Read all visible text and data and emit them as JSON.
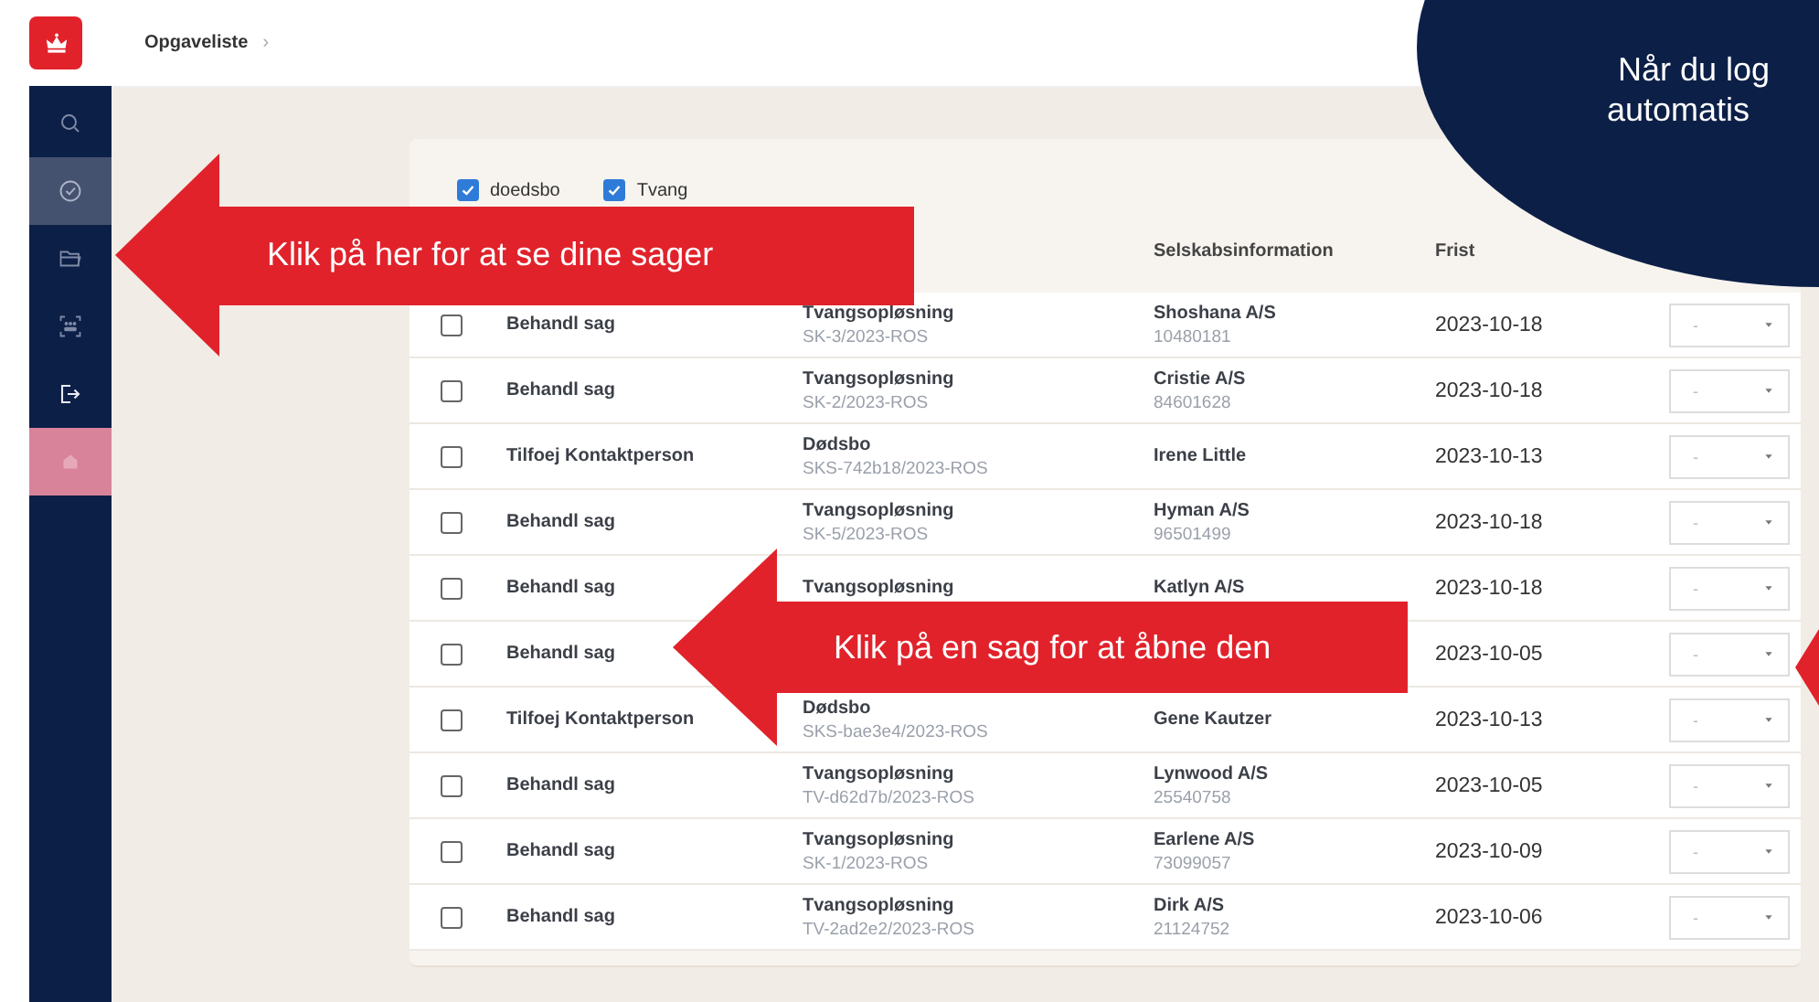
{
  "header": {
    "breadcrumb": "Opgaveliste",
    "separator": "›"
  },
  "sidebar": {
    "items": [
      {
        "kind": "search",
        "selected": false
      },
      {
        "kind": "check",
        "selected": true
      },
      {
        "kind": "folder",
        "selected": false
      },
      {
        "kind": "group",
        "selected": false
      },
      {
        "kind": "logout",
        "selected": false
      },
      {
        "kind": "profile",
        "selected": false
      }
    ]
  },
  "filters": [
    {
      "label": "doedsbo",
      "checked": true
    },
    {
      "label": "Tvang",
      "checked": true
    }
  ],
  "table": {
    "columns": {
      "company": "Selskabsinformation",
      "deadline": "Frist"
    },
    "rows": [
      {
        "checked": false,
        "task": "Behandl sag",
        "case_type": "Tvangsopløsning",
        "case_no": "SK-3/2023-ROS",
        "company": "Shoshana A/S",
        "cvr": "10480181",
        "deadline": "2023-10-18",
        "status": "-"
      },
      {
        "checked": false,
        "task": "Behandl sag",
        "case_type": "Tvangsopløsning",
        "case_no": "SK-2/2023-ROS",
        "company": "Cristie A/S",
        "cvr": "84601628",
        "deadline": "2023-10-18",
        "status": "-"
      },
      {
        "checked": false,
        "task": "Tilfoej Kontaktperson",
        "case_type": "Dødsbo",
        "case_no": "SKS-742b18/2023-ROS",
        "company": "Irene Little",
        "deadline": "2023-10-13",
        "status": "-"
      },
      {
        "checked": false,
        "task": "Behandl sag",
        "case_type": "Tvangsopløsning",
        "case_no": "SK-5/2023-ROS",
        "company": "Hyman A/S",
        "cvr": "96501499",
        "deadline": "2023-10-18",
        "status": "-"
      },
      {
        "checked": false,
        "task": "Behandl sag",
        "case_type": "Tvangsopløsning",
        "company": "Katlyn A/S",
        "deadline": "2023-10-18",
        "status": "-"
      },
      {
        "checked": false,
        "task": "Behandl sag",
        "deadline": "2023-10-05",
        "status": "-"
      },
      {
        "checked": false,
        "task": "Tilfoej Kontaktperson",
        "case_type": "Dødsbo",
        "case_no": "SKS-bae3e4/2023-ROS",
        "company": "Gene Kautzer",
        "deadline": "2023-10-13",
        "status": "-"
      },
      {
        "checked": false,
        "task": "Behandl sag",
        "case_type": "Tvangsopløsning",
        "case_no": "TV-d62d7b/2023-ROS",
        "company": "Lynwood A/S",
        "cvr": "25540758",
        "deadline": "2023-10-05",
        "status": "-"
      },
      {
        "checked": false,
        "task": "Behandl sag",
        "case_type": "Tvangsopløsning",
        "case_no": "SK-1/2023-ROS",
        "company": "Earlene A/S",
        "cvr": "73099057",
        "deadline": "2023-10-09",
        "status": "-"
      },
      {
        "checked": false,
        "task": "Behandl sag",
        "case_type": "Tvangsopløsning",
        "case_no": "TV-2ad2e2/2023-ROS",
        "company": "Dirk A/S",
        "cvr": "21124752",
        "deadline": "2023-10-06",
        "status": "-"
      }
    ]
  },
  "callouts": [
    {
      "kind": "arrow",
      "text": "Klik på her for at se dine sager"
    },
    {
      "kind": "arrow",
      "text": "Klik på en sag for at åbne den"
    },
    {
      "kind": "bubble",
      "lines": [
        "Når du log",
        "automatis"
      ]
    },
    {
      "kind": "arrow-tip"
    }
  ]
}
